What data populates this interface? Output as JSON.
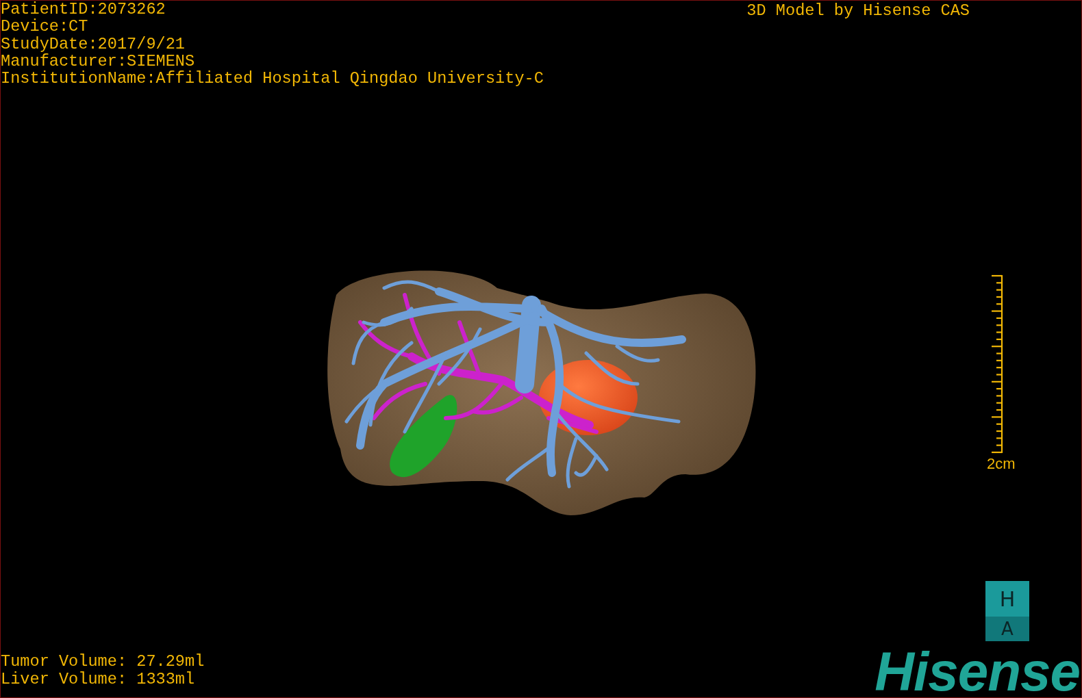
{
  "patient_info": [
    "PatientID:2073262",
    "Device:CT",
    "StudyDate:2017/9/21",
    "Manufacturer:SIEMENS",
    "InstitutionName:Affiliated Hospital Qingdao University-C"
  ],
  "credit": "3D Model by Hisense CAS",
  "scale_bar": {
    "label": "2cm"
  },
  "volumes": [
    "Tumor Volume: 27.29ml",
    "Liver Volume: 1333ml"
  ],
  "orientation_cube": {
    "top_face": "H",
    "front_face": "A"
  },
  "logo": "Hisense"
}
